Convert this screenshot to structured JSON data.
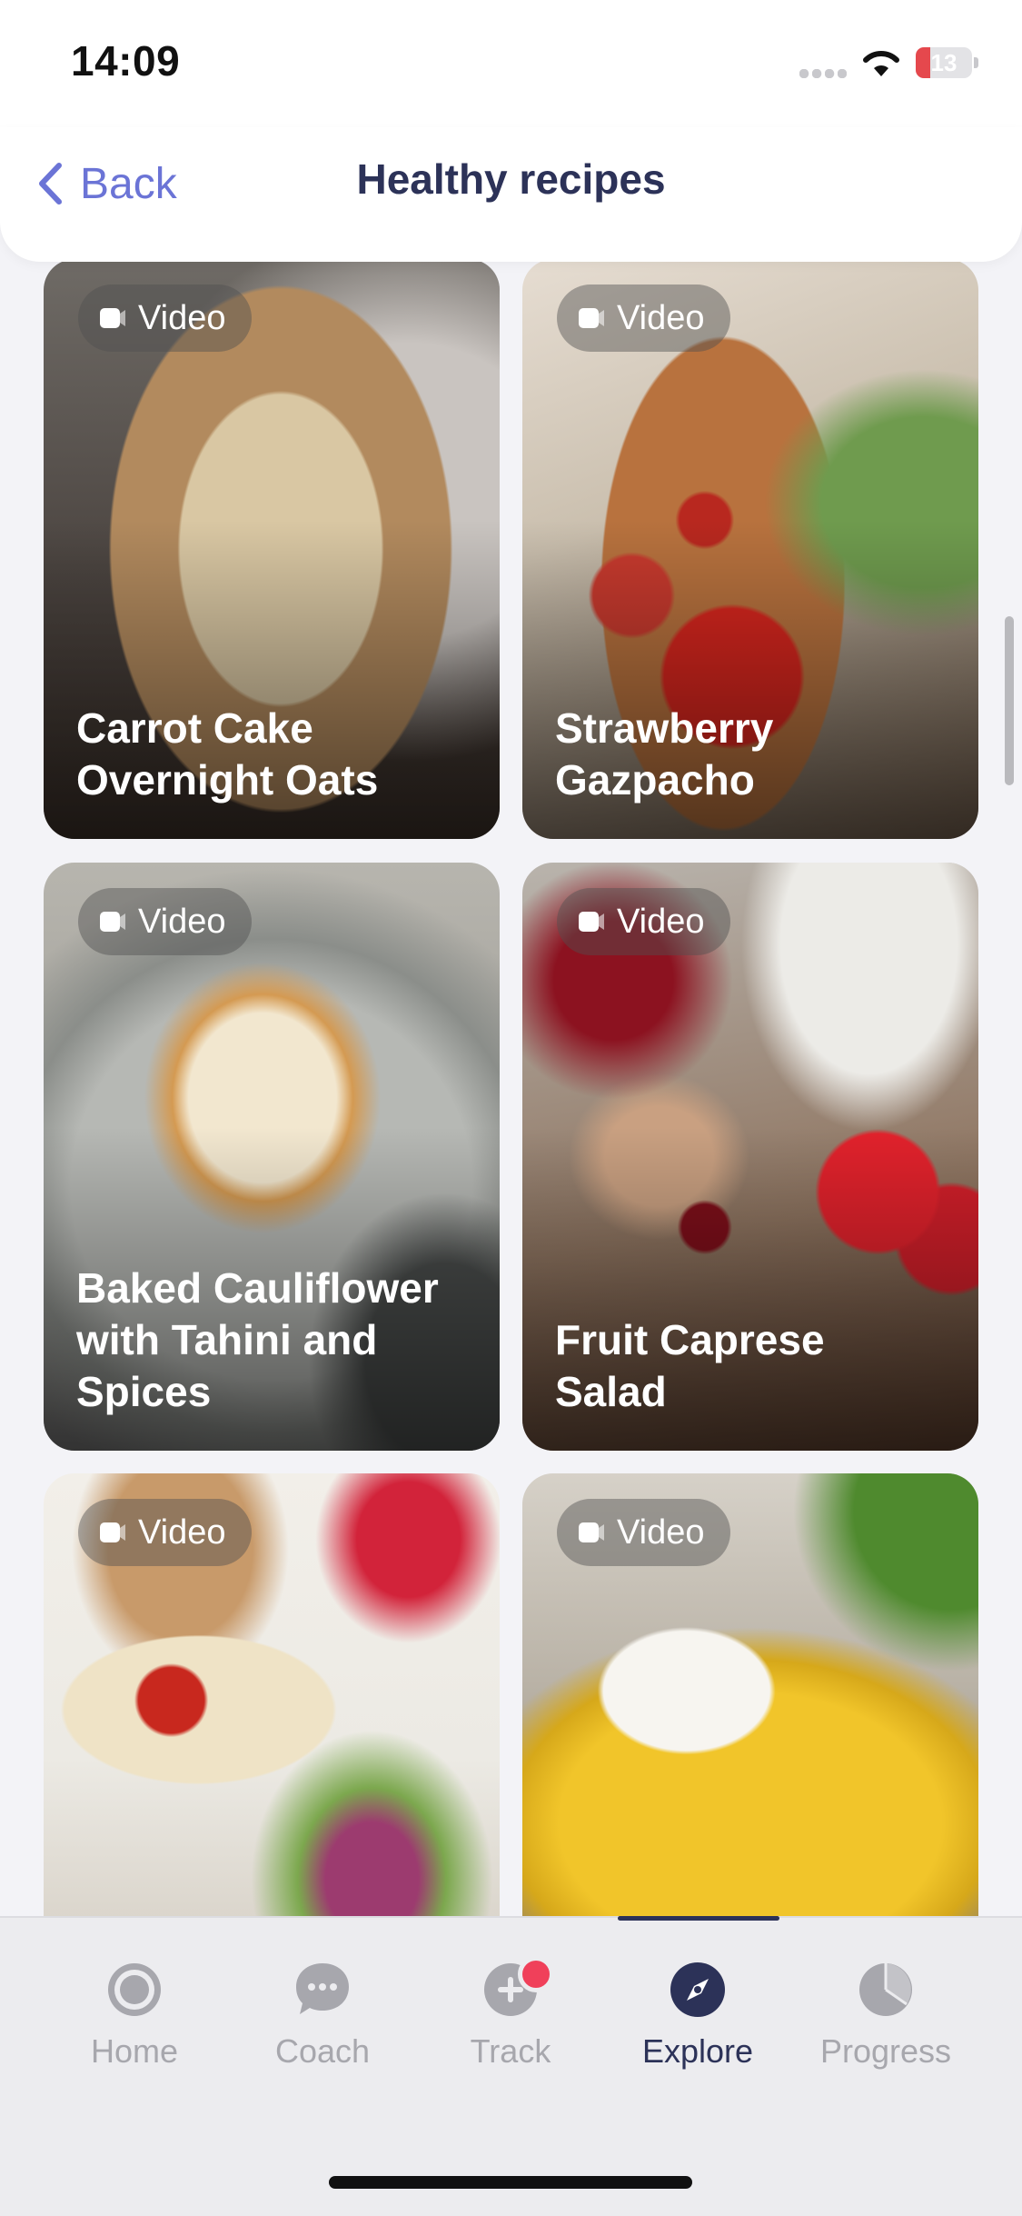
{
  "status": {
    "time": "14:09",
    "battery": "13",
    "battery_level": 0.13
  },
  "header": {
    "back_label": "Back",
    "title": "Healthy recipes"
  },
  "recipes": [
    {
      "badge": "Video",
      "title": "Carrot Cake\nOvernight Oats"
    },
    {
      "badge": "Video",
      "title": "Strawberry\nGazpacho"
    },
    {
      "badge": "Video",
      "title": "Baked Cauliflower\nwith Tahini and\nSpices"
    },
    {
      "badge": "Video",
      "title": "Fruit Caprese\nSalad"
    },
    {
      "badge": "Video",
      "title": ""
    },
    {
      "badge": "Video",
      "title": ""
    }
  ],
  "tabs": [
    {
      "label": "Home",
      "icon": "home-target-icon"
    },
    {
      "label": "Coach",
      "icon": "chat-bubble-icon"
    },
    {
      "label": "Track",
      "icon": "plus-circle-icon"
    },
    {
      "label": "Explore",
      "icon": "compass-icon",
      "active": true
    },
    {
      "label": "Progress",
      "icon": "pie-chart-icon"
    }
  ],
  "colors": {
    "accent": "#6b74d6",
    "title": "#2c3258",
    "notification_dot": "#f0405a"
  }
}
